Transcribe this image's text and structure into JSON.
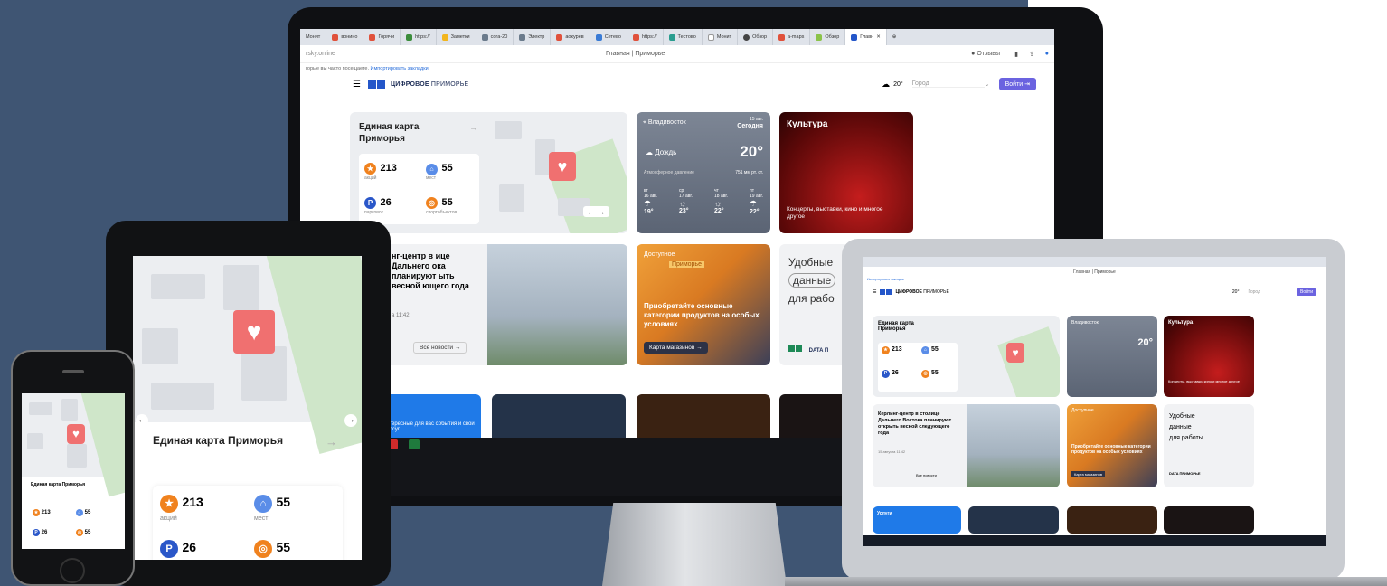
{
  "browser": {
    "tabs": [
      "Монит",
      "вонино",
      "Горячи",
      "https://",
      "Заметки",
      "cora-20",
      "Электр",
      "аокурев",
      "Сетево",
      "https://",
      "Тестово",
      "Монит",
      "Обзор",
      "a-maps",
      "Обзор",
      "Главн"
    ],
    "url": "rsky.online",
    "page_title": "Главная | Приморье",
    "bookmarks_hint": "горые вы часто посещаете.",
    "bookmarks_link": "Импортировать закладки",
    "feedback": "Отзывы"
  },
  "site": {
    "logo": "ЦИФРОВОЕ",
    "logo_light": "ПРИМОРЬЕ",
    "temp": "20°",
    "city_placeholder": "Город",
    "login": "Войти"
  },
  "card_map": {
    "title": "Единая карта Приморья",
    "stats": [
      {
        "value": "213",
        "label": "акций",
        "icon": "star-icon",
        "color": "#f0821e"
      },
      {
        "value": "55",
        "label": "мест",
        "icon": "museum-icon",
        "color": "#5a8de8"
      },
      {
        "value": "26",
        "label": "парковок",
        "icon": "parking-icon",
        "color": "#2a57c9"
      },
      {
        "value": "55",
        "label": "спортобъектов",
        "icon": "sport-icon",
        "color": "#f0821e"
      }
    ]
  },
  "weather": {
    "city": "Владивосток",
    "date": "15 авг.",
    "today": "Сегодня",
    "desc": "Дождь",
    "temp": "20°",
    "pressure_label": "Атмосферное давление",
    "pressure": "751 мм рт. ст.",
    "forecast": [
      {
        "day": "вт",
        "date": "16 авг.",
        "temp": "19°"
      },
      {
        "day": "ср",
        "date": "17 авг.",
        "temp": "23°"
      },
      {
        "day": "чт",
        "date": "18 авг.",
        "temp": "22°"
      },
      {
        "day": "пт",
        "date": "19 авг.",
        "temp": "22°"
      }
    ]
  },
  "culture": {
    "title": "Культура",
    "desc": "Концерты, выставки, кино и многое другое"
  },
  "news": {
    "title": "Керлинг-центр в столице Дальнего Востока планируют открыть весной следующего года",
    "title_monitor": "нг-центр в ице Дальнего ока планируют ыть весной ющего года",
    "date": "15 августа 11:42",
    "date_monitor": "а 11:42",
    "all": "Все новости"
  },
  "promo": {
    "tag1": "Доступное",
    "tag2": "Приморье",
    "text": "Приобретайте основные категории продуктов на особых условиях",
    "btn": "Карта магазинов"
  },
  "data_card": {
    "l1": "Удобные",
    "l2": "данные",
    "l3": "для работы",
    "l3_monitor": "для рабо",
    "logo": "DATA",
    "logo2": "ПРИМОРЬЕ",
    "logo_monitor": "DATA П"
  },
  "services": {
    "title": "Услуги",
    "desc": "Найдите интересные для вас события и проведите свой досуг",
    "desc_monitor": "нтересные для вас события и свой досуг"
  },
  "tablet": {
    "title": "Единая карта Приморья",
    "v1": "213",
    "l1": "акций",
    "v2": "55",
    "l2": "мест",
    "v3": "26",
    "v4": "55"
  },
  "phone": {
    "title": "Единая карта Приморья",
    "v1": "213",
    "v2": "55",
    "v3": "26",
    "v4": "55"
  },
  "laptop": {
    "page_title": "Главная | Приморье"
  }
}
